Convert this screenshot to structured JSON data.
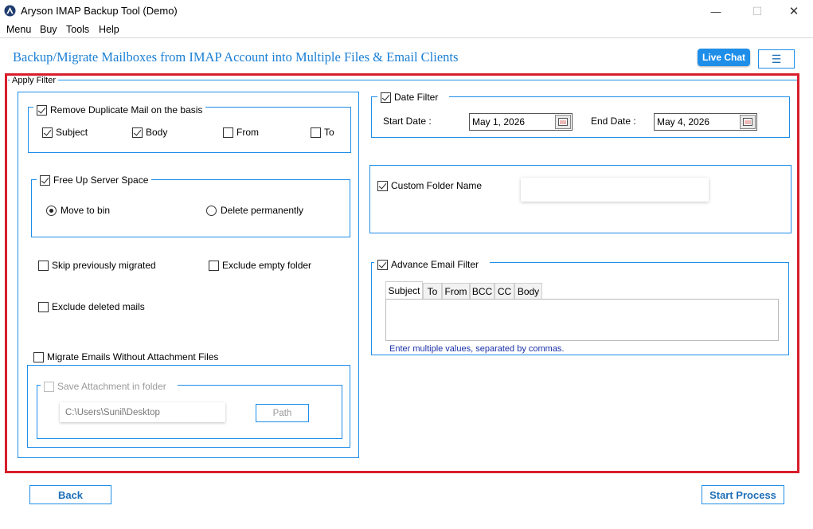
{
  "window": {
    "title": "Aryson IMAP Backup Tool (Demo)",
    "minimize": "—",
    "maximize": "☐",
    "close": "✕"
  },
  "menubar": {
    "items": [
      "Menu",
      "Buy",
      "Tools",
      "Help"
    ]
  },
  "header": {
    "title": "Backup/Migrate Mailboxes from IMAP Account into Multiple Files & Email Clients",
    "live_chat": "Live Chat",
    "hamburger": "☰"
  },
  "apply_filter": {
    "title": "Apply Filter"
  },
  "remove_duplicate": {
    "label": "Remove Duplicate Mail on the basis",
    "checked": true,
    "options": [
      {
        "label": "Subject",
        "checked": true
      },
      {
        "label": "Body",
        "checked": true
      },
      {
        "label": "From",
        "checked": false
      },
      {
        "label": "To",
        "checked": false
      }
    ]
  },
  "free_up": {
    "label": "Free Up Server Space",
    "checked": true,
    "move_to_bin": "Move to bin",
    "delete_permanently": "Delete permanently",
    "selected": "Move to bin"
  },
  "misc": {
    "skip_previously_migrated": "Skip previously migrated",
    "exclude_empty_folder": "Exclude empty folder",
    "exclude_deleted_mails": "Exclude deleted mails"
  },
  "attachments": {
    "migrate_without_attachment": "Migrate Emails Without Attachment Files",
    "save_attachment": "Save Attachment in folder",
    "path_value": "C:\\Users\\Sunil\\Desktop",
    "path_button": "Path"
  },
  "date_filter": {
    "label": "Date Filter",
    "checked": true,
    "start_label": "Start Date :",
    "start_value": "May 1, 2026",
    "end_label": "End Date :",
    "end_value": "May 4, 2026"
  },
  "custom_folder": {
    "label": "Custom Folder Name",
    "checked": true,
    "value": ""
  },
  "advance_filter": {
    "label": "Advance Email Filter",
    "checked": true,
    "tabs": [
      "Subject",
      "To",
      "From",
      "BCC",
      "CC",
      "Body"
    ],
    "active_tab": "Subject",
    "hint": "Enter multiple values, separated by commas.",
    "hint_color": "#1a2fa8"
  },
  "footer": {
    "back": "Back",
    "start_process": "Start Process"
  },
  "colors": {
    "accent": "#1e8ee9",
    "highlight_border": "#d81e2b",
    "title_blue": "#1a7fd4"
  }
}
